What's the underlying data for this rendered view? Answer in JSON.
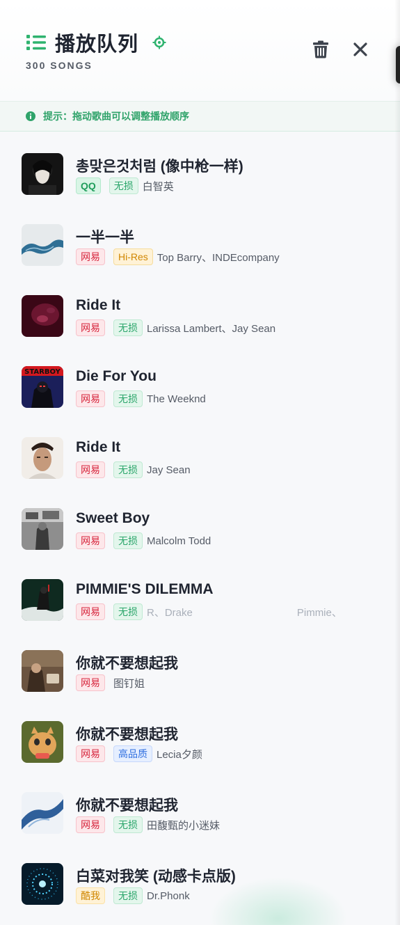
{
  "header": {
    "title": "播放队列",
    "count": "300 SONGS",
    "accent": "#2fb36f"
  },
  "tip": {
    "text": "提示：拖动歌曲可以调整播放顺序"
  },
  "songs": [
    {
      "title": "총맞은것처럼 (像中枪一样)",
      "source": "QQ",
      "quality": "无损",
      "artist": "白智英"
    },
    {
      "title": "一半一半",
      "source": "网易",
      "quality": "Hi-Res",
      "artist": "Top Barry、INDEcompany"
    },
    {
      "title": "Ride It",
      "source": "网易",
      "quality": "无损",
      "artist": "Larissa Lambert、Jay Sean"
    },
    {
      "title": "Die For You",
      "source": "网易",
      "quality": "无损",
      "artist": "The Weeknd"
    },
    {
      "title": "Ride It",
      "source": "网易",
      "quality": "无损",
      "artist": "Jay Sean"
    },
    {
      "title": "Sweet Boy",
      "source": "网易",
      "quality": "无损",
      "artist": "Malcolm Todd"
    },
    {
      "title": "PIMMIE'S DILEMMA",
      "source": "网易",
      "quality": "无损",
      "artist_a": "R、Drake",
      "artist_b": "Pimmie、"
    },
    {
      "title": "你就不要想起我",
      "source": "网易",
      "artist": "图钉姐"
    },
    {
      "title": "你就不要想起我",
      "source": "网易",
      "quality": "高品质",
      "artist": "Lecia夕颜"
    },
    {
      "title": "你就不要想起我",
      "source": "网易",
      "quality": "无损",
      "artist": "田馥甄的小迷妹"
    },
    {
      "title": "白菜对我笑 (动感卡点版)",
      "source": "酷我",
      "quality": "无损",
      "artist": "Dr.Phonk"
    }
  ],
  "cover_art_text": "STARBOY"
}
